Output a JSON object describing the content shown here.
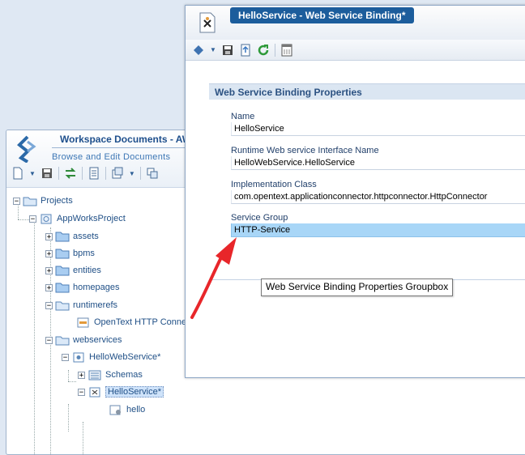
{
  "workspace": {
    "title": "Workspace Documents - AW",
    "subtitle": "Browse and Edit Documents",
    "tree": {
      "projects": "Projects",
      "appworks_project": "AppWorksProject",
      "assets": "assets",
      "bpms": "bpms",
      "entities": "entities",
      "homepages": "homepages",
      "runtimerefs": "runtimerefs",
      "opentext_http": "OpenText HTTP Connect",
      "webservices": "webservices",
      "hello_web_service": "HelloWebService*",
      "schemas": "Schemas",
      "hello_service": "HelloService*",
      "hello": "hello"
    }
  },
  "binding_window": {
    "title": "HelloService - Web Service Binding*",
    "groupbox_title": "Web Service Binding Properties",
    "fields": [
      {
        "label": "Name",
        "value": "HelloService"
      },
      {
        "label": "Runtime Web service Interface Name",
        "value": "HelloWebService.HelloService"
      },
      {
        "label": "Implementation Class",
        "value": "com.opentext.applicationconnector.httpconnector.HttpConnector"
      },
      {
        "label": "Service Group",
        "value": "HTTP-Service"
      }
    ]
  },
  "tooltip": "Web Service Binding Properties Groupbox",
  "colors": {
    "title_tab": "#1c5d9c",
    "highlight": "#a8d6f7",
    "arrow": "#e8262a"
  }
}
